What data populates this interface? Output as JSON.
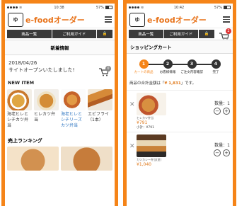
{
  "left": {
    "status": {
      "time": "10:38",
      "battery": "57%"
    },
    "header": {
      "logo_mascot": "ゆ",
      "logo_text": "e-foodオーダー"
    },
    "nav": {
      "items_label": "商品一覧",
      "guide_label": "ご利用ガイド",
      "lock_icon": "lock-icon"
    },
    "news": {
      "title": "新着情報",
      "date": "2018/04/26",
      "text": "サイトオープンいたしました!",
      "cart_badge": "0"
    },
    "new_item": {
      "heading": "NEW ITEM",
      "items": [
        {
          "name": "海老ヒレとシチカツ弁当",
          "link": false
        },
        {
          "name": "ヒレカツ弁当",
          "link": false
        },
        {
          "name": "海老ヒレとシチリーズカツ弁当",
          "link": true
        },
        {
          "name": "エビフライ（1本）",
          "link": false
        }
      ]
    },
    "ranking": {
      "heading": "売上ランキング"
    }
  },
  "right": {
    "status": {
      "time": "10:42",
      "battery": "57%"
    },
    "header": {
      "logo_mascot": "ゆ",
      "logo_text": "e-foodオーダー"
    },
    "nav": {
      "items_label": "商品一覧",
      "guide_label": "ご利用ガイド",
      "lock_icon": "lock-icon"
    },
    "cart": {
      "title": "ショッピングカート",
      "badge": "2",
      "steps": [
        {
          "num": "1",
          "label": "カートの商品",
          "active": true
        },
        {
          "num": "2",
          "label": "お客様情報",
          "active": false
        },
        {
          "num": "3",
          "label": "ご注文内容確認",
          "active": false
        },
        {
          "num": "4",
          "label": "完了",
          "active": false
        }
      ],
      "total_prefix": "商品の合計金額は「",
      "total_amount": "¥ 1,831",
      "total_suffix": "」です。",
      "items": [
        {
          "name": "ヒレカツ弁当",
          "price": "¥791",
          "subtotal": "小計：¥791",
          "qty_label": "数量：1"
        },
        {
          "name": "カツカレー弁当(並)",
          "price": "¥1,040",
          "subtotal": "",
          "qty_label": "数量：1"
        }
      ]
    }
  },
  "colors": {
    "accent": "#f58418",
    "dark": "#3a3a3a",
    "price": "#e07a1c",
    "link": "#2a73c0"
  }
}
